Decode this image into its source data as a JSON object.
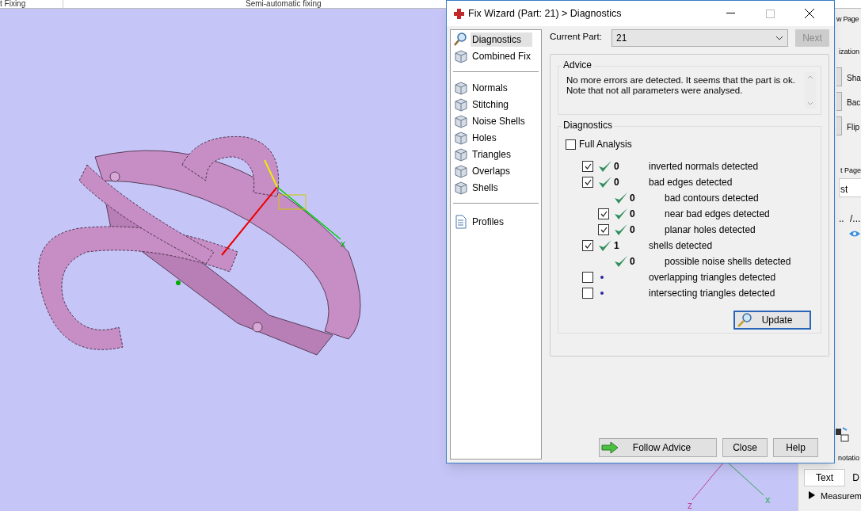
{
  "top_bar": {
    "tabs": [
      "t Fixing",
      "Semi-automatic fixing"
    ]
  },
  "viewport": {
    "axis_labels": [
      {
        "text": "x",
        "kind": "gizmo"
      },
      {
        "text": "z",
        "kind": "corner"
      },
      {
        "text": "x",
        "kind": "corner"
      }
    ]
  },
  "dialog": {
    "title": "Fix Wizard (Part: 21) > Diagnostics",
    "nav_groups": [
      [
        {
          "label": "Diagnostics",
          "kind": "search",
          "selected": true
        },
        {
          "label": "Combined Fix",
          "kind": "cube",
          "selected": false
        }
      ],
      [
        {
          "label": "Normals",
          "kind": "cube",
          "selected": false
        },
        {
          "label": "Stitching",
          "kind": "cube",
          "selected": false
        },
        {
          "label": "Noise Shells",
          "kind": "cube",
          "selected": false
        },
        {
          "label": "Holes",
          "kind": "cube",
          "selected": false
        },
        {
          "label": "Triangles",
          "kind": "cube",
          "selected": false
        },
        {
          "label": "Overlaps",
          "kind": "cube",
          "selected": false
        },
        {
          "label": "Shells",
          "kind": "cube",
          "selected": false
        }
      ],
      [
        {
          "label": "Profiles",
          "kind": "document",
          "selected": false
        }
      ]
    ],
    "current_part": {
      "label": "Current Part:",
      "value": "21"
    },
    "next_button": {
      "label": "Next",
      "disabled": true
    },
    "advice": {
      "legend": "Advice",
      "text": "No more errors are detected. It seems that the part is ok.\nNote that not all parameters were analysed."
    },
    "diagnostics": {
      "legend": "Diagnostics",
      "full_analysis": {
        "label": "Full Analysis",
        "checked": false
      },
      "rows": [
        {
          "kind": "checkable",
          "checked": true,
          "passed": true,
          "count": "0",
          "label": "inverted normals detected"
        },
        {
          "kind": "checkable",
          "checked": true,
          "passed": true,
          "count": "0",
          "label": "bad edges detected",
          "children": [
            {
              "kind": "plain",
              "passed": true,
              "count": "0",
              "label": "bad contours detected"
            },
            {
              "kind": "checkable",
              "checked": true,
              "passed": true,
              "count": "0",
              "label": "near bad edges detected"
            },
            {
              "kind": "checkable",
              "checked": true,
              "passed": true,
              "count": "0",
              "label": "planar holes detected"
            }
          ]
        },
        {
          "kind": "checkable",
          "checked": true,
          "passed": true,
          "count": "1",
          "label": "shells detected",
          "children": [
            {
              "kind": "plain",
              "passed": true,
              "count": "0",
              "label": "possible noise shells detected"
            }
          ]
        },
        {
          "kind": "checkable",
          "checked": false,
          "passed": false,
          "label": "overlapping triangles detected"
        },
        {
          "kind": "checkable",
          "checked": false,
          "passed": false,
          "label": "intersecting triangles detected"
        }
      ],
      "update_button": "Update"
    },
    "footer_buttons": [
      {
        "label": "Follow Advice",
        "kind": "arrow"
      },
      {
        "label": "Close",
        "kind": "plain"
      },
      {
        "label": "Help",
        "kind": "plain"
      }
    ]
  },
  "side_panel": {
    "top": [
      "w Page",
      "ization"
    ],
    "buttons": [
      "Sha",
      "Bac",
      "Flip"
    ],
    "section": "t Page",
    "tab": "st",
    "row": [
      "..",
      "/..."
    ],
    "annotation": "notatio",
    "tabs": [
      {
        "label": "Text",
        "selected": true
      },
      {
        "label": "D",
        "selected": false
      }
    ],
    "tree_item": "Measurem"
  }
}
